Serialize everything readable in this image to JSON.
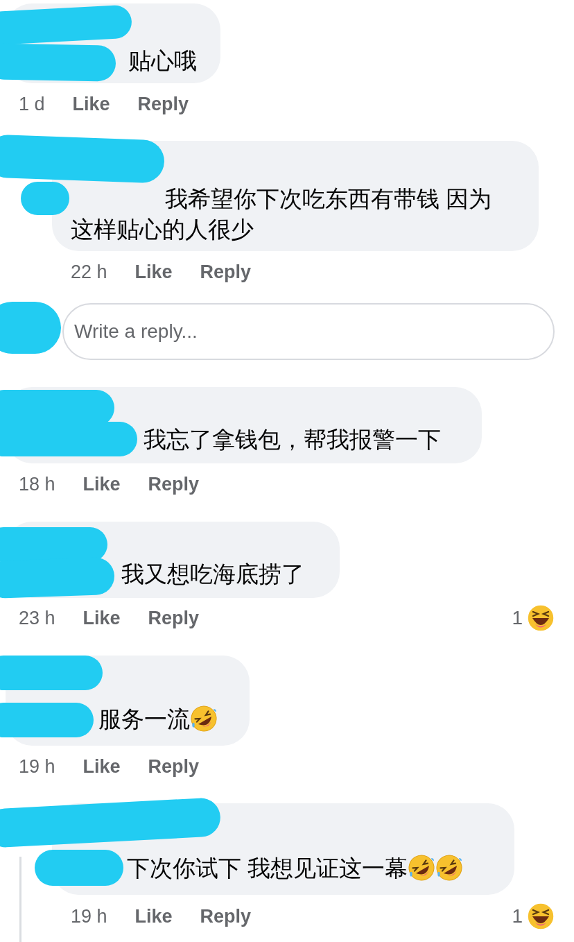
{
  "items": [
    {
      "kind": "comment",
      "nested": false,
      "thread_line": false,
      "segments": [
        {
          "kind": "text",
          "text": "贴心哦"
        }
      ],
      "time": "1 d",
      "like": "Like",
      "reply": "Reply"
    },
    {
      "kind": "comment",
      "nested": true,
      "thread_line": false,
      "segments": [
        {
          "kind": "text",
          "text": "我希望你下次吃东西有带钱 因为这样贴心的人很少"
        }
      ],
      "time": "22 h",
      "like": "Like",
      "reply": "Reply"
    },
    {
      "kind": "reply_box",
      "placeholder": "Write a reply..."
    },
    {
      "kind": "comment",
      "nested": false,
      "thread_line": false,
      "segments": [
        {
          "kind": "text",
          "text": "我忘了拿钱包，帮我报警一下"
        }
      ],
      "time": "18 h",
      "like": "Like",
      "reply": "Reply"
    },
    {
      "kind": "comment",
      "nested": false,
      "thread_line": false,
      "segments": [
        {
          "kind": "text",
          "text": "我又想吃海底捞了"
        }
      ],
      "time": "23 h",
      "like": "Like",
      "reply": "Reply",
      "reaction": {
        "count": "1"
      }
    },
    {
      "kind": "comment",
      "nested": false,
      "thread_line": false,
      "segments": [
        {
          "kind": "text",
          "text": "服务一流"
        },
        {
          "kind": "emoji"
        }
      ],
      "time": "19 h",
      "like": "Like",
      "reply": "Reply"
    },
    {
      "kind": "comment",
      "nested": true,
      "thread_line": true,
      "segments": [
        {
          "kind": "text",
          "text": "下次你试下 我想见证这一幕"
        },
        {
          "kind": "emoji"
        },
        {
          "kind": "emoji"
        }
      ],
      "time": "19 h",
      "like": "Like",
      "reply": "Reply",
      "reaction": {
        "count": "1"
      }
    }
  ]
}
